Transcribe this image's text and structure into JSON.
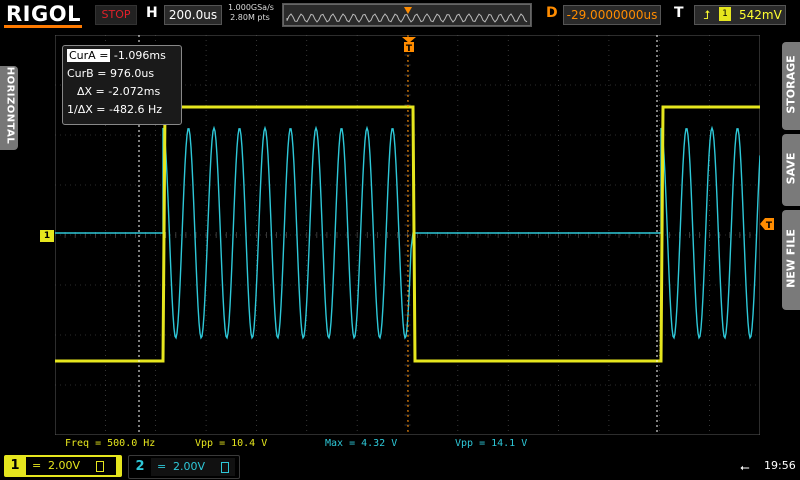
{
  "brand": "RIGOL",
  "run_state": "STOP",
  "horizontal": {
    "label": "H",
    "timebase": "200.0us",
    "sample_rate": "1.000GSa/s",
    "memory_depth": "2.80M pts",
    "delay_label": "D",
    "delay": "-29.0000000us"
  },
  "trigger": {
    "label": "T",
    "source": "1",
    "level": "542mV"
  },
  "left_menu": {
    "tab": "HORIZONTAL"
  },
  "right_menu": {
    "tabs": [
      "STORAGE",
      "SAVE",
      "NEW FILE"
    ]
  },
  "cursors": {
    "cur_a_label": "CurA =",
    "cur_a": "-1.096ms",
    "cur_b_label": "CurB =",
    "cur_b": "976.0us",
    "dx_label": "ΔX =",
    "dx": "-2.072ms",
    "inv_dx_label": "1/ΔX =",
    "inv_dx": "-482.6 Hz"
  },
  "measurements": [
    {
      "text": "Freq = 500.0 Hz",
      "color": "#e6e61e"
    },
    {
      "text": "Vpp = 10.4 V",
      "color": "#e6e61e"
    },
    {
      "text": "Max = 4.32 V",
      "color": "#2ec8d8"
    },
    {
      "text": "Vpp = 14.1 V",
      "color": "#2ec8d8"
    }
  ],
  "channels": [
    {
      "num": "1",
      "coupling": "=",
      "scale": "2.00V",
      "color": "#e6e61e"
    },
    {
      "num": "2",
      "coupling": "=",
      "scale": "2.00V",
      "color": "#2ec8d8"
    }
  ],
  "marker_ch1": "1",
  "clock": "19:56",
  "colors": {
    "ch1": "#e6e61e",
    "ch2": "#2ec8d8",
    "trigger_orange": "#ff8c00",
    "grid": "#5a5a5a"
  }
}
